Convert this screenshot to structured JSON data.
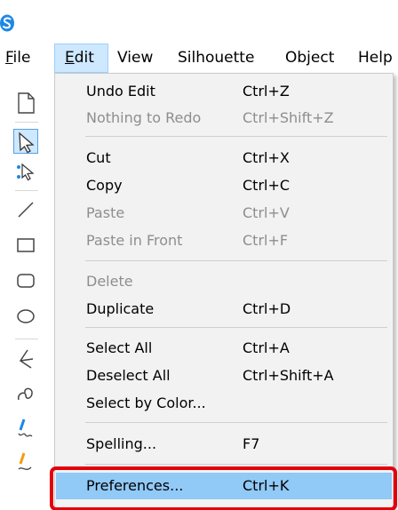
{
  "app": {
    "logo_icon": "silhouette-logo-icon",
    "accent": "#1e88e5"
  },
  "menubar": {
    "items": [
      {
        "label": "File",
        "mnemonic": "F",
        "rest": "ile"
      },
      {
        "label": "Edit",
        "mnemonic": "E",
        "rest": "dit",
        "active": true
      },
      {
        "label": "View"
      },
      {
        "label": "Silhouette"
      },
      {
        "label": "Object"
      },
      {
        "label": "Help"
      }
    ]
  },
  "toolbar": {
    "tools": [
      "new-document-icon",
      "select-arrow-icon",
      "point-edit-icon",
      "line-icon",
      "rectangle-icon",
      "rounded-rectangle-icon",
      "ellipse-icon",
      "polygon-icon",
      "curve-icon",
      "freehand-draw-icon",
      "smooth-freehand-icon"
    ]
  },
  "edit_menu": {
    "items": [
      {
        "label": "Undo Edit",
        "shortcut": "Ctrl+Z",
        "enabled": true
      },
      {
        "label": "Nothing to Redo",
        "shortcut": "Ctrl+Shift+Z",
        "enabled": false
      },
      {
        "label": "Cut",
        "shortcut": "Ctrl+X",
        "enabled": true
      },
      {
        "label": "Copy",
        "shortcut": "Ctrl+C",
        "enabled": true
      },
      {
        "label": "Paste",
        "shortcut": "Ctrl+V",
        "enabled": false
      },
      {
        "label": "Paste in Front",
        "shortcut": "Ctrl+F",
        "enabled": false
      },
      {
        "label": "Delete",
        "shortcut": "",
        "enabled": false
      },
      {
        "label": "Duplicate",
        "shortcut": "Ctrl+D",
        "enabled": true
      },
      {
        "label": "Select All",
        "shortcut": "Ctrl+A",
        "enabled": true
      },
      {
        "label": "Deselect All",
        "shortcut": "Ctrl+Shift+A",
        "enabled": true
      },
      {
        "label": "Select by Color...",
        "shortcut": "",
        "enabled": true
      },
      {
        "label": "Spelling...",
        "shortcut": "F7",
        "enabled": true
      },
      {
        "label": "Preferences...",
        "shortcut": "Ctrl+K",
        "enabled": true,
        "highlighted": true
      }
    ]
  },
  "annotation": {
    "color": "#e3000b",
    "target": "Preferences..."
  }
}
